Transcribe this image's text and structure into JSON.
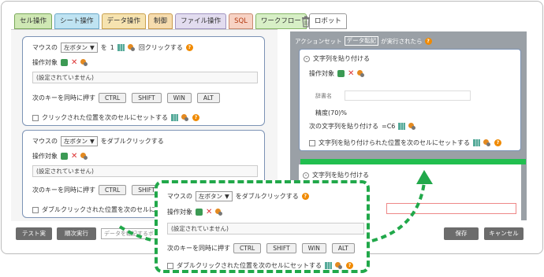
{
  "tabs": [
    "セル操作",
    "シート操作",
    "データ操作",
    "制御",
    "ファイル操作",
    "SQL",
    "ワークフロー",
    "ロボット"
  ],
  "block1": {
    "mouse_label": "マウスの",
    "button_select": "左ボタン",
    "wo": "を",
    "count": "1",
    "click_suffix": "回クリックする",
    "target_label": "操作対象",
    "target_value": "(設定されていません)",
    "keys_label": "次のキーを同時に押す",
    "keys": [
      "CTRL",
      "SHIFT",
      "WIN",
      "ALT"
    ],
    "set_pos_label": "クリックされた位置を次のセルにセットする"
  },
  "block2": {
    "mouse_label": "マウスの",
    "button_select": "左ボタン",
    "action": "をダブルクリックする",
    "target_label": "操作対象",
    "target_value": "(設定されていません)",
    "keys_label": "次のキーを同時に押す",
    "keys": [
      "CTRL",
      "SHIFT"
    ],
    "set_pos_label": "ダブルクリックされた位置を次のセルにセットす"
  },
  "zoom": {
    "mouse_label": "マウスの",
    "button_select": "左ボタン",
    "action": "をダブルクリックする",
    "target_label": "操作対象",
    "target_value": "(設定されていません)",
    "keys_label": "次のキーを同時に押す",
    "keys": [
      "CTRL",
      "SHIFT",
      "WIN",
      "ALT"
    ],
    "set_pos_label": "ダブルクリックされた位置を次のセルにセットする"
  },
  "right": {
    "header_prefix": "アクションセット",
    "header_tag": "データ転記",
    "header_suffix": "が実行されたら",
    "block_title": "文字列を貼り付ける",
    "target_label": "操作対象",
    "dict_label": "辞書名",
    "precision": "精度(70)%",
    "next_text_label": "次の文字列を貼り付ける",
    "next_text_value": "=C6",
    "set_pos_label": "文字列を貼り付けられた位置を次のセルにセットする",
    "block2_title": "文字列を貼り付ける"
  },
  "footer": {
    "test_run": "テスト実行",
    "step_run": "順次実行",
    "search_placeholder": "データを転記するボ",
    "save": "保存",
    "cancel": "キャンセル"
  }
}
